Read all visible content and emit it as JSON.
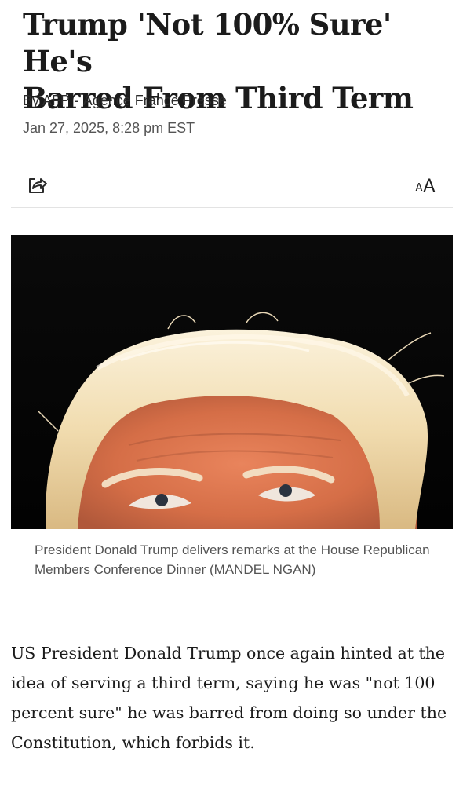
{
  "article": {
    "headline_line1": "Trump 'Not 100% Sure' He's",
    "headline_line2": "Barred From Third Term",
    "byline_prefix": "By ",
    "author": "AFP",
    "byline_separator": "-",
    "agency": "Agence France Presse",
    "date": "Jan 27, 2025, 8:28 pm EST"
  },
  "toolbar": {
    "share_icon": "share-icon",
    "text_size_small": "A",
    "text_size_large": "A"
  },
  "photo": {
    "caption": "President Donald Trump delivers remarks at the House Republican Members Conference Dinner (MANDEL NGAN)"
  },
  "body": {
    "paragraph_1": "US President Donald Trump once again hinted at the idea of serving a third term, saying he was \"not 100 percent sure\" he was barred from doing so under the Constitution, which forbids it."
  },
  "colors": {
    "headline": "#1b1b1b",
    "meta": "#555555",
    "caption": "#545454",
    "divider": "#e3e3e3"
  }
}
